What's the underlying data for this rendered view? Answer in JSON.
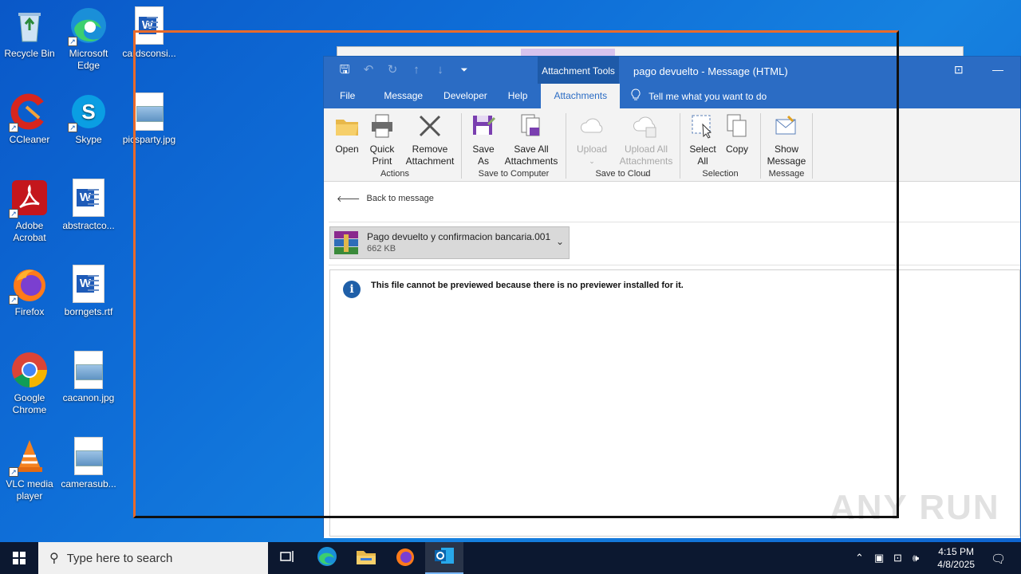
{
  "desktop": {
    "icons": [
      {
        "label": "Recycle Bin",
        "icon": "recycle-bin-icon"
      },
      {
        "label": "Microsoft Edge",
        "icon": "edge-icon"
      },
      {
        "label": "cardsconsi...",
        "icon": "word-document-icon"
      },
      {
        "label": "CCleaner",
        "icon": "ccleaner-icon"
      },
      {
        "label": "Skype",
        "icon": "skype-icon"
      },
      {
        "label": "picsparty.jpg",
        "icon": "image-file-icon"
      },
      {
        "label": "Adobe Acrobat",
        "icon": "acrobat-icon"
      },
      {
        "label": "abstractco...",
        "icon": "word-document-icon"
      },
      {
        "label": "Firefox",
        "icon": "firefox-icon"
      },
      {
        "label": "borngets.rtf",
        "icon": "word-document-icon"
      },
      {
        "label": "Google Chrome",
        "icon": "chrome-icon"
      },
      {
        "label": "cacanon.jpg",
        "icon": "image-file-icon"
      },
      {
        "label": "VLC media player",
        "icon": "vlc-icon"
      },
      {
        "label": "camerasub...",
        "icon": "image-file-icon"
      }
    ]
  },
  "outlook": {
    "context_tab": "Attachment Tools",
    "window_title": "pago devuelto  -  Message (HTML)",
    "tabs": [
      "File",
      "Message",
      "Developer",
      "Help",
      "Attachments"
    ],
    "active_tab": "Attachments",
    "tell_me": "Tell me what you want to do",
    "ribbon": {
      "actions": {
        "label": "Actions",
        "open": "Open",
        "quick_print_1": "Quick",
        "quick_print_2": "Print",
        "remove_1": "Remove",
        "remove_2": "Attachment"
      },
      "save_computer": {
        "label": "Save to Computer",
        "save_as_1": "Save",
        "save_as_2": "As",
        "save_all_1": "Save All",
        "save_all_2": "Attachments"
      },
      "save_cloud": {
        "label": "Save to Cloud",
        "upload": "Upload",
        "upload_all_1": "Upload All",
        "upload_all_2": "Attachments"
      },
      "selection": {
        "label": "Selection",
        "select_all_1": "Select",
        "select_all_2": "All",
        "copy": "Copy"
      },
      "message": {
        "label": "Message",
        "show_1": "Show",
        "show_2": "Message"
      }
    },
    "back_link": "Back to message",
    "attachment": {
      "name": "Pago devuelto y confirmacion bancaria.001",
      "size": "662 KB"
    },
    "preview_message": "This file cannot be previewed because there is no previewer installed for it."
  },
  "watermark": "ANY RUN",
  "taskbar": {
    "search_placeholder": "Type here to search",
    "time": "4:15 PM",
    "date": "4/8/2025"
  }
}
